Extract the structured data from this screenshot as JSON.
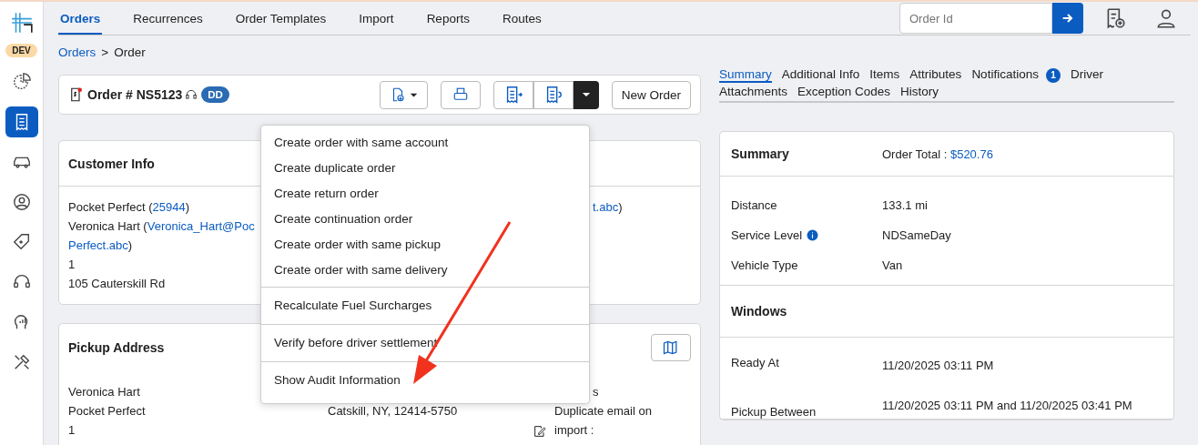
{
  "sidebar": {
    "badge": "DEV",
    "items": [
      {
        "selected": false
      },
      {
        "selected": true
      },
      {
        "selected": false
      },
      {
        "selected": false
      },
      {
        "selected": false
      },
      {
        "selected": false
      },
      {
        "selected": false
      },
      {
        "selected": false
      }
    ]
  },
  "nav": {
    "tabs": [
      {
        "label": "Orders",
        "selected": true
      },
      {
        "label": "Recurrences",
        "selected": false
      },
      {
        "label": "Order Templates",
        "selected": false
      },
      {
        "label": "Import",
        "selected": false
      },
      {
        "label": "Reports",
        "selected": false
      },
      {
        "label": "Routes",
        "selected": false
      }
    ],
    "search": {
      "placeholder": "Order Id"
    }
  },
  "breadcrumb": {
    "link": "Orders",
    "separator": ">",
    "current": "Order"
  },
  "order": {
    "title": "Order # NS5123",
    "badge": "DD",
    "new_button": "New Order"
  },
  "menu": {
    "groups": [
      [
        "Create order with same account",
        "Create duplicate order",
        "Create return order",
        "Create continuation order",
        "Create order with same pickup",
        "Create order with same delivery"
      ],
      [
        "Recalculate Fuel Surcharges"
      ],
      [
        "Verify before driver settlement"
      ],
      [
        "Show Audit Information"
      ]
    ]
  },
  "customer_info": {
    "title": "Customer Info",
    "lines": [
      {
        "text": "Pocket Perfect (",
        "link": "25944",
        "after": ")"
      },
      {
        "text": "Veronica Hart (",
        "link": "Veronica_Hart@Poc"
      },
      {
        "link": "Perfect.abc",
        "after": ")"
      },
      {
        "text": "1"
      },
      {
        "text": "105 Cauterskill Rd"
      }
    ],
    "right_lines": [
      {
        "link": "t.abc",
        "after": ")"
      }
    ]
  },
  "pickup_address": {
    "title": "Pickup Address",
    "col1": [
      "Veronica Hart",
      "Pocket Perfect",
      "1"
    ],
    "col2": [
      "Catskill, NY, 12414-5750"
    ],
    "col3": [
      "s",
      "Duplicate email on",
      "import :"
    ]
  },
  "detail_tabs": [
    {
      "label": "Summary",
      "selected": true
    },
    {
      "label": "Additional Info",
      "selected": false
    },
    {
      "label": "Items",
      "selected": false
    },
    {
      "label": "Attributes",
      "selected": false
    },
    {
      "label": "Notifications",
      "selected": false,
      "count": "1"
    },
    {
      "label": "Driver",
      "selected": false
    },
    {
      "label": "Attachments",
      "selected": false
    },
    {
      "label": "Exception Codes",
      "selected": false
    },
    {
      "label": "History",
      "selected": false
    }
  ],
  "summary": {
    "title": "Summary",
    "total_label": "Order Total :",
    "total": "$520.76",
    "rows": [
      {
        "label": "Distance",
        "value": "133.1 mi",
        "info": false
      },
      {
        "label": "Service Level",
        "value": "NDSameDay",
        "info": true
      },
      {
        "label": "Vehicle Type",
        "value": "Van",
        "info": false
      }
    ],
    "windows_title": "Windows",
    "windows": [
      {
        "label": "Ready At",
        "values": [
          "11/20/2025 03:11 PM"
        ]
      },
      {
        "label": "Pickup Between",
        "values": [
          "11/20/2025 03:11 PM",
          "and",
          "11/20/2025 03:41 PM"
        ]
      }
    ]
  }
}
